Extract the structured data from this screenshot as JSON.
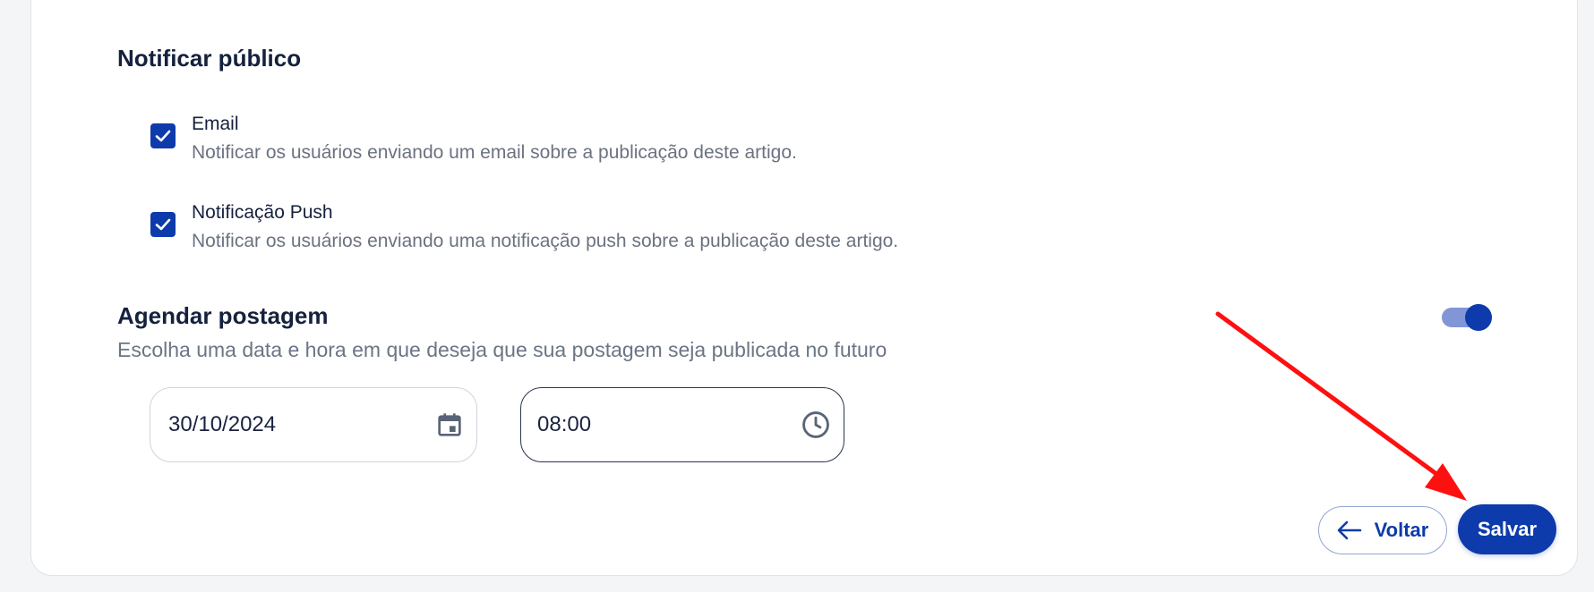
{
  "notify": {
    "title": "Notificar público",
    "options": [
      {
        "label": "Email",
        "description": "Notificar os usuários enviando um email sobre a publicação deste artigo.",
        "checked": true
      },
      {
        "label": "Notificação Push",
        "description": "Notificar os usuários enviando uma notificação push sobre a publicação deste artigo.",
        "checked": true
      }
    ]
  },
  "schedule": {
    "title": "Agendar postagem",
    "subtitle": "Escolha uma data e hora em que deseja que sua postagem seja publicada no futuro",
    "enabled": true,
    "date": {
      "value": "30/10/2024",
      "icon": "calendar-icon"
    },
    "time": {
      "value": "08:00",
      "icon": "clock-icon"
    }
  },
  "actions": {
    "back_label": "Voltar",
    "back_icon": "arrow-left-icon",
    "save_label": "Salvar"
  },
  "colors": {
    "primary": "#0e3bab",
    "annotation_arrow": "#ff0000"
  }
}
